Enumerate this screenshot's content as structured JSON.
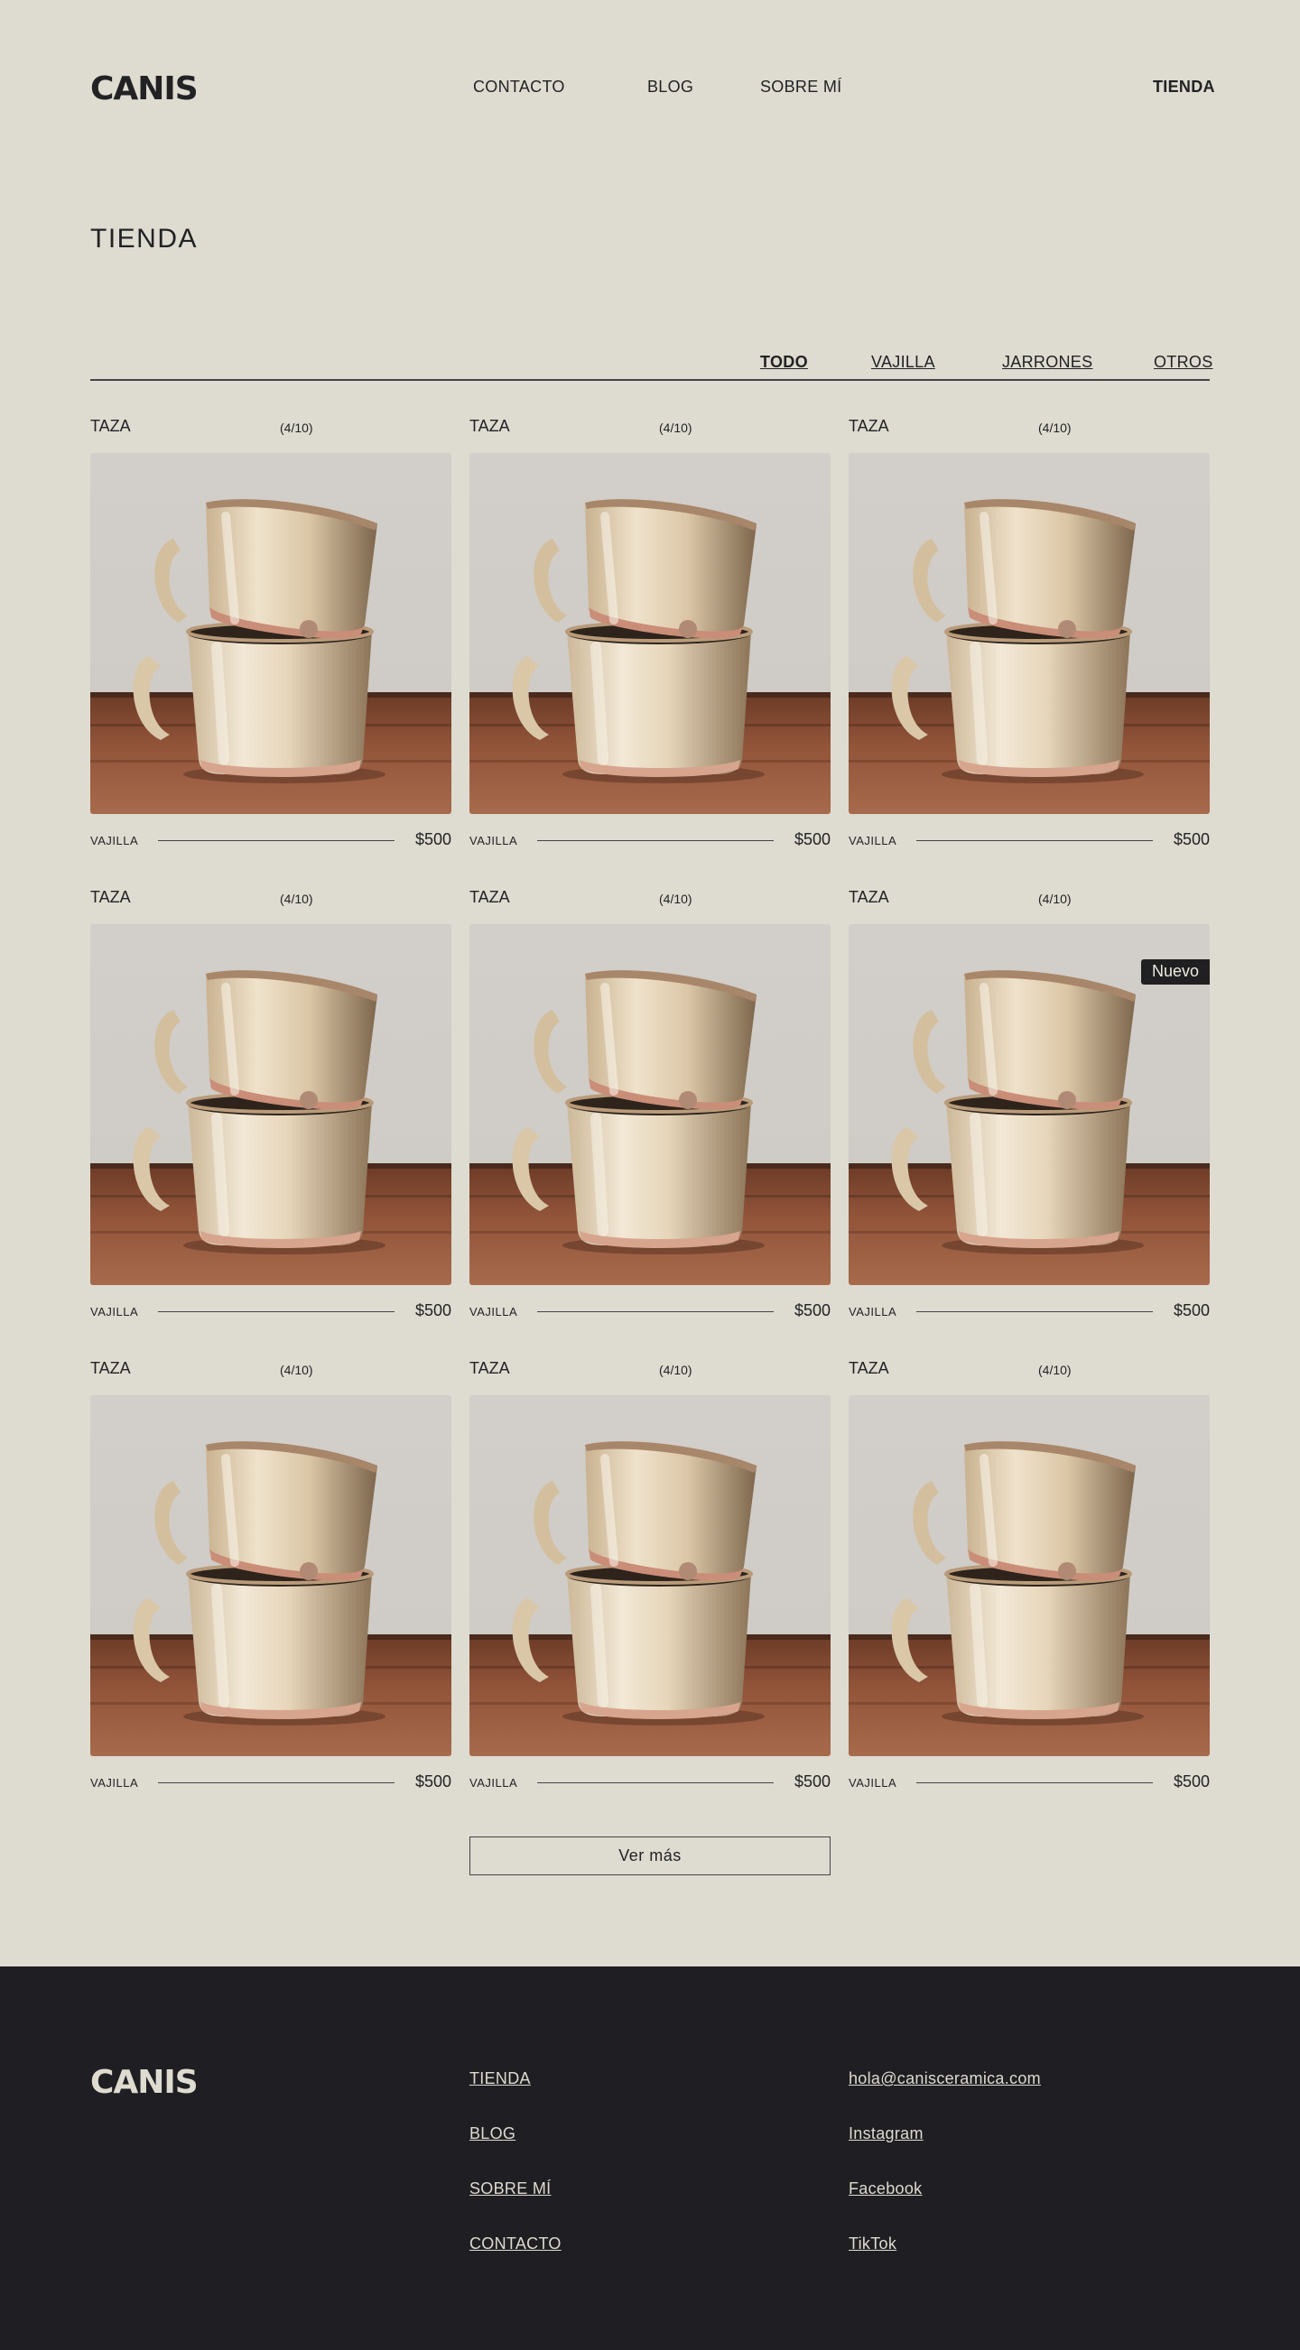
{
  "header": {
    "logo": "CANIS",
    "nav": {
      "contacto": "CONTACTO",
      "blog": "BLOG",
      "sobre": "SOBRE MÍ",
      "tienda": "TIENDA"
    }
  },
  "page_title": "TIENDA",
  "filters": {
    "todo": "TODO",
    "vajilla": "VAJILLA",
    "jarrones": "JARRONES",
    "otros": "OTROS",
    "active": "TODO"
  },
  "products": [
    {
      "name": "TAZA",
      "stock": "(4/10)",
      "category": "VAJILLA",
      "price": "$500",
      "badge": ""
    },
    {
      "name": "TAZA",
      "stock": "(4/10)",
      "category": "VAJILLA",
      "price": "$500",
      "badge": ""
    },
    {
      "name": "TAZA",
      "stock": "(4/10)",
      "category": "VAJILLA",
      "price": "$500",
      "badge": ""
    },
    {
      "name": "TAZA",
      "stock": "(4/10)",
      "category": "VAJILLA",
      "price": "$500",
      "badge": ""
    },
    {
      "name": "TAZA",
      "stock": "(4/10)",
      "category": "VAJILLA",
      "price": "$500",
      "badge": ""
    },
    {
      "name": "TAZA",
      "stock": "(4/10)",
      "category": "VAJILLA",
      "price": "$500",
      "badge": "Nuevo"
    },
    {
      "name": "TAZA",
      "stock": "(4/10)",
      "category": "VAJILLA",
      "price": "$500",
      "badge": ""
    },
    {
      "name": "TAZA",
      "stock": "(4/10)",
      "category": "VAJILLA",
      "price": "$500",
      "badge": ""
    },
    {
      "name": "TAZA",
      "stock": "(4/10)",
      "category": "VAJILLA",
      "price": "$500",
      "badge": ""
    }
  ],
  "more_button": "Ver más",
  "footer": {
    "logo": "CANIS",
    "nav": [
      "TIENDA",
      "BLOG",
      "SOBRE MÍ",
      "CONTACTO"
    ],
    "contact": [
      "hola@canisceramica.com",
      "Instagram",
      "Facebook",
      "TikTok"
    ]
  },
  "colors": {
    "background": "#dedbd0",
    "text": "#222224",
    "footer_background": "#1f1f23",
    "footer_text": "#dedbd0",
    "badge_background": "#202022"
  }
}
